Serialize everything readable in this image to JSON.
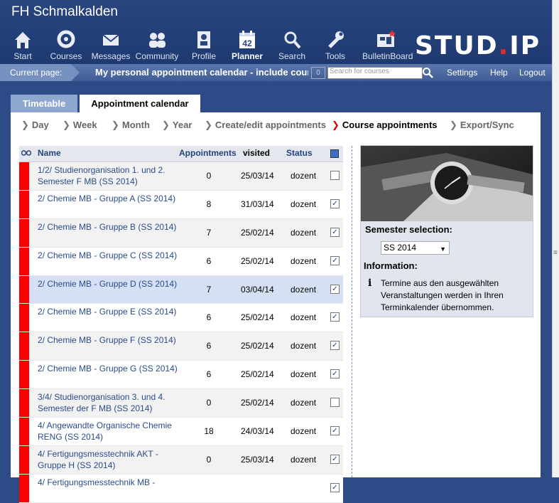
{
  "app_title": "FH Schmalkalden",
  "nav": [
    {
      "label": "Start",
      "icon": "home-icon"
    },
    {
      "label": "Courses",
      "icon": "courses-icon"
    },
    {
      "label": "Messages",
      "icon": "envelope-icon"
    },
    {
      "label": "Community",
      "icon": "community-icon"
    },
    {
      "label": "Profile",
      "icon": "profile-icon"
    },
    {
      "label": "Planner",
      "icon": "calendar-icon",
      "badge": "42"
    },
    {
      "label": "Search",
      "icon": "search-icon"
    },
    {
      "label": "Tools",
      "icon": "tools-icon"
    },
    {
      "label": "BulletinBoard",
      "icon": "bulletin-icon"
    }
  ],
  "logo_text": "STUD",
  "logo_dot": ".",
  "logo_text2": "IP",
  "breadcrumb": {
    "label": "Current page:",
    "text": "My personal appointment calendar - include courses",
    "count": "0",
    "search_placeholder": "Search for courses"
  },
  "top_links": {
    "settings": "Settings",
    "help": "Help",
    "logout": "Logout"
  },
  "tabs": {
    "timetable": "Timetable",
    "appointment": "Appointment calendar"
  },
  "subnav": [
    "Day",
    "Week",
    "Month",
    "Year",
    "Create/edit appointments",
    "Course appointments",
    "Export/Sync"
  ],
  "table": {
    "headers": {
      "name": "Name",
      "appointments": "Appointments",
      "visited": "visited",
      "status": "Status"
    },
    "rows": [
      {
        "name": "1/2/ Studienorganisation 1. und 2. Semester F MB (SS 2014)",
        "appointments": "0",
        "visited": "25/03/14",
        "status": "dozent",
        "checked": false
      },
      {
        "name": "2/ Chemie MB - Gruppe A (SS 2014)",
        "appointments": "8",
        "visited": "31/03/14",
        "status": "dozent",
        "checked": true
      },
      {
        "name": "2/ Chemie MB - Gruppe B (SS 2014)",
        "appointments": "7",
        "visited": "25/02/14",
        "status": "dozent",
        "checked": true
      },
      {
        "name": "2/ Chemie MB - Gruppe C (SS 2014)",
        "appointments": "6",
        "visited": "25/02/14",
        "status": "dozent",
        "checked": true
      },
      {
        "name": "2/ Chemie MB - Gruppe D (SS 2014)",
        "appointments": "7",
        "visited": "03/04/14",
        "status": "dozent",
        "checked": true
      },
      {
        "name": "2/ Chemie MB - Gruppe E (SS 2014)",
        "appointments": "6",
        "visited": "25/02/14",
        "status": "dozent",
        "checked": true
      },
      {
        "name": "2/ Chemie MB - Gruppe F (SS 2014)",
        "appointments": "6",
        "visited": "25/02/14",
        "status": "dozent",
        "checked": true
      },
      {
        "name": "2/ Chemie MB - Gruppe G (SS 2014)",
        "appointments": "6",
        "visited": "25/02/14",
        "status": "dozent",
        "checked": true
      },
      {
        "name": "3/4/ Studienorganisation 3. und 4. Semester der F MB (SS 2014)",
        "appointments": "0",
        "visited": "25/02/14",
        "status": "dozent",
        "checked": false
      },
      {
        "name": "4/ Angewandte Organische Chemie RENG (SS 2014)",
        "appointments": "18",
        "visited": "24/03/14",
        "status": "dozent",
        "checked": true
      },
      {
        "name": "4/ Fertigungsmesstechnik AKT - Gruppe H (SS 2014)",
        "appointments": "0",
        "visited": "25/03/14",
        "status": "dozent",
        "checked": true
      },
      {
        "name": "4/ Fertigungsmesstechnik MB -",
        "appointments": "",
        "visited": "",
        "status": "",
        "checked": true
      }
    ]
  },
  "sidebar": {
    "semester_label": "Semester selection:",
    "semester_value": "SS 2014",
    "info_label": "Information:",
    "info_text": "Termine aus den ausgewählten Veranstaltungen werden in Ihren Terminkalender übernommen."
  }
}
